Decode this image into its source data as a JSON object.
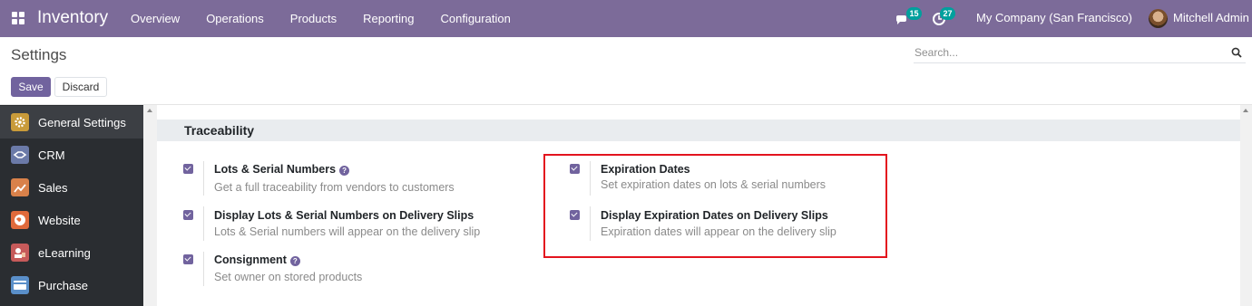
{
  "navbar": {
    "app_name": "Inventory",
    "menu": [
      "Overview",
      "Operations",
      "Products",
      "Reporting",
      "Configuration"
    ],
    "messages_count": "15",
    "activities_count": "27",
    "company": "My Company (San Francisco)",
    "user": "Mitchell Admin",
    "color": "#7c6b99"
  },
  "control_panel": {
    "title": "Settings",
    "search_placeholder": "Search...",
    "save_label": "Save",
    "discard_label": "Discard"
  },
  "sidebar": {
    "items": [
      {
        "label": "General Settings",
        "icon": "gear-icon",
        "color": "#c99b3a"
      },
      {
        "label": "CRM",
        "icon": "handshake-icon",
        "color": "#6b7aa8"
      },
      {
        "label": "Sales",
        "icon": "chart-icon",
        "color": "#d9814a"
      },
      {
        "label": "Website",
        "icon": "globe-icon",
        "color": "#e06a3c"
      },
      {
        "label": "eLearning",
        "icon": "elearning-icon",
        "color": "#c65a5a"
      },
      {
        "label": "Purchase",
        "icon": "credit-card-icon",
        "color": "#5a8fc9"
      }
    ]
  },
  "section": {
    "title": "Traceability",
    "settings": [
      {
        "label": "Lots & Serial Numbers",
        "description": "Get a full traceability from vendors to customers",
        "checked": true,
        "help": true
      },
      {
        "label": "Display Lots & Serial Numbers on Delivery Slips",
        "description": "Lots & Serial numbers will appear on the delivery slip",
        "checked": true,
        "help": false
      },
      {
        "label": "Consignment",
        "description": "Set owner on stored products",
        "checked": true,
        "help": true
      },
      {
        "label": "Expiration Dates",
        "description": "Set expiration dates on lots & serial numbers",
        "checked": true,
        "help": false
      },
      {
        "label": "Display Expiration Dates on Delivery Slips",
        "description": "Expiration dates will appear on the delivery slip",
        "checked": true,
        "help": false
      }
    ]
  },
  "help_glyph": "?"
}
